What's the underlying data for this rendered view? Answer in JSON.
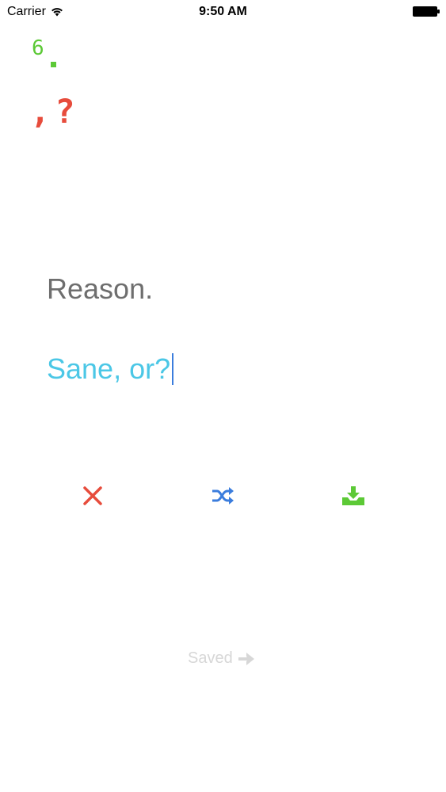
{
  "status_bar": {
    "carrier": "Carrier",
    "time": "9:50 AM",
    "icons": [
      "wifi-icon",
      "battery-icon"
    ]
  },
  "counter": {
    "value": "6"
  },
  "punctuation": {
    "text": ",?"
  },
  "sentence": {
    "prompt": "Reason.",
    "answer": "Sane, or?"
  },
  "actions": {
    "discard_icon": "close-x-icon",
    "shuffle_icon": "shuffle-icon",
    "save_icon": "download-tray-icon"
  },
  "footer": {
    "saved_label": "Saved",
    "saved_icon": "arrow-right-icon"
  },
  "colors": {
    "green": "#5cc936",
    "red": "#e74c3c",
    "blue": "#3b7ddd",
    "cyan": "#4bc7e6",
    "gray_text": "#6e6e6e",
    "light_gray": "#d7d7d7"
  }
}
